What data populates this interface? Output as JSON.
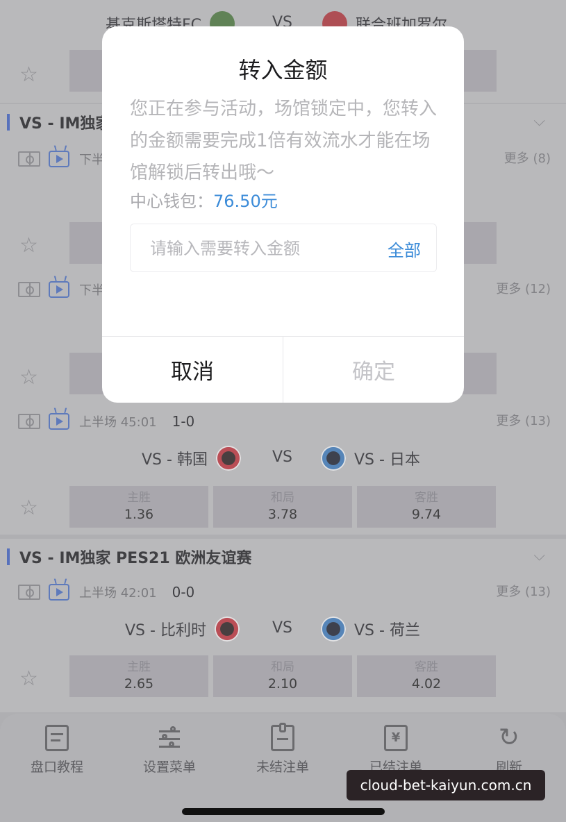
{
  "top_match": {
    "home": "基克斯塔特FC",
    "vs": "VS",
    "away": "联合班加罗尔"
  },
  "league_1": {
    "name": "VS - IM独家"
  },
  "match_a": {
    "period": "下半",
    "more": "更多 (8)"
  },
  "match_b": {
    "period": "下半",
    "more": "更多 (12)"
  },
  "match_c": {
    "period": "上半场 45:01",
    "score": "1-0",
    "more": "更多 (13)",
    "home": "VS - 韩国",
    "vs": "VS",
    "away": "VS - 日本",
    "odds": [
      {
        "label": "主胜",
        "value": "1.36"
      },
      {
        "label": "和局",
        "value": "3.78"
      },
      {
        "label": "客胜",
        "value": "9.74"
      }
    ]
  },
  "league_2": {
    "name": "VS - IM独家 PES21 欧洲友谊赛"
  },
  "match_d": {
    "period": "上半场 42:01",
    "score": "0-0",
    "more": "更多 (13)",
    "home": "VS - 比利时",
    "vs": "VS",
    "away": "VS - 荷兰",
    "odds": [
      {
        "label": "主胜",
        "value": "2.65"
      },
      {
        "label": "和局",
        "value": "2.10"
      },
      {
        "label": "客胜",
        "value": "4.02"
      }
    ]
  },
  "modal": {
    "title": "转入金额",
    "message": "您正在参与活动，场馆锁定中，您转入的金额需要完成1倍有效流水才能在场馆解锁后转出哦～",
    "wallet_label": "中心钱包：",
    "wallet_amount": "76.50元",
    "input_placeholder": "请输入需要转入金额",
    "all_label": "全部",
    "cancel_label": "取消",
    "confirm_label": "确定"
  },
  "bottom_tabs": [
    {
      "label": "盘口教程",
      "icon": "document-icon"
    },
    {
      "label": "设置菜单",
      "icon": "sliders-icon"
    },
    {
      "label": "未结注单",
      "icon": "clipboard-icon"
    },
    {
      "label": "已结注单",
      "icon": "yen-receipt-icon"
    },
    {
      "label": "刷新",
      "icon": "refresh-icon"
    }
  ],
  "watermark": "cloud-bet-kaiyun.com.cn",
  "colors": {
    "accent_blue": "#3b8bd8",
    "league_bar": "#3f63c9",
    "odds_bg": "#b0aeb4",
    "card_bg": "#c6c6c8"
  }
}
